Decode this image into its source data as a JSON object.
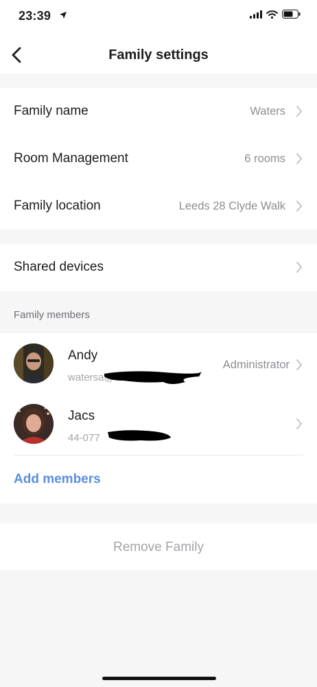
{
  "status_bar": {
    "time": "23:39"
  },
  "nav": {
    "title": "Family settings"
  },
  "settings": [
    {
      "label": "Family name",
      "value": "Waters"
    },
    {
      "label": "Room Management",
      "value": "6 rooms"
    },
    {
      "label": "Family location",
      "value": "Leeds 28 Clyde Walk"
    }
  ],
  "shared_devices": {
    "label": "Shared devices"
  },
  "members_section": {
    "header": "Family members",
    "members": [
      {
        "name": "Andy",
        "sub": "watersa@",
        "role": "Administrator"
      },
      {
        "name": "Jacs",
        "sub": "44-077",
        "role": ""
      }
    ],
    "add_label": "Add members"
  },
  "remove": {
    "label": "Remove Family"
  },
  "colors": {
    "accent": "#5b8de0",
    "background": "#f6f6f7",
    "muted_text": "#8e8e93"
  }
}
